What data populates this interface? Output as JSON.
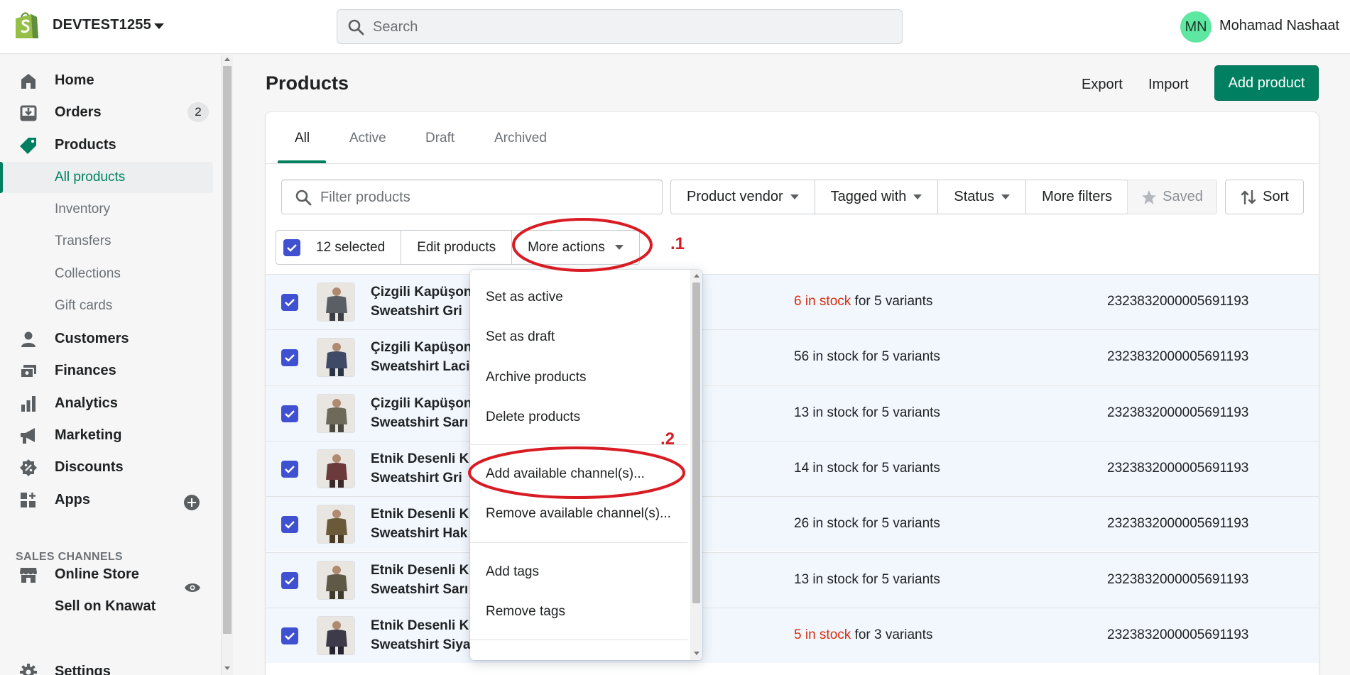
{
  "topbar": {
    "store_name": "DEVTEST1255",
    "search_placeholder": "Search",
    "avatar_initials": "MN",
    "user_name": "Mohamad Nashaat"
  },
  "sidebar": {
    "items": [
      {
        "label": "Home",
        "icon": "home-icon"
      },
      {
        "label": "Orders",
        "icon": "orders-icon",
        "badge": "2"
      },
      {
        "label": "Products",
        "icon": "tag-icon"
      },
      {
        "label": "All products"
      },
      {
        "label": "Inventory"
      },
      {
        "label": "Transfers"
      },
      {
        "label": "Collections"
      },
      {
        "label": "Gift cards"
      },
      {
        "label": "Customers",
        "icon": "person-icon"
      },
      {
        "label": "Finances",
        "icon": "finances-icon"
      },
      {
        "label": "Analytics",
        "icon": "bar-chart-icon"
      },
      {
        "label": "Marketing",
        "icon": "megaphone-icon"
      },
      {
        "label": "Discounts",
        "icon": "discount-icon"
      },
      {
        "label": "Apps",
        "icon": "apps-icon"
      }
    ],
    "sales_channels_title": "SALES CHANNELS",
    "channels": [
      {
        "label": "Online Store",
        "icon": "store-icon"
      },
      {
        "label": "Sell on Knawat"
      }
    ],
    "settings_label": "Settings"
  },
  "page": {
    "title": "Products",
    "export_label": "Export",
    "import_label": "Import",
    "add_label": "Add product"
  },
  "tabs": [
    "All",
    "Active",
    "Draft",
    "Archived"
  ],
  "filters": {
    "placeholder": "Filter products",
    "vendor": "Product vendor",
    "tagged": "Tagged with",
    "status": "Status",
    "more": "More filters",
    "saved": "Saved",
    "sort": "Sort"
  },
  "bulk": {
    "selected": "12 selected",
    "edit": "Edit products",
    "more_actions": "More actions"
  },
  "rows": [
    {
      "name1": "Çizgili Kapüşon",
      "name2": "Sweatshirt Gri",
      "stock": "6 in stock",
      "variants": " for 5 variants",
      "low": true,
      "vendor": "2323832000005691193"
    },
    {
      "name1": "Çizgili Kapüşon",
      "name2": "Sweatshirt Laci",
      "stock": "56 in stock",
      "variants": " for 5 variants",
      "low": false,
      "vendor": "2323832000005691193"
    },
    {
      "name1": "Çizgili Kapüşon",
      "name2": "Sweatshirt Sarı",
      "stock": "13 in stock",
      "variants": " for 5 variants",
      "low": false,
      "vendor": "2323832000005691193"
    },
    {
      "name1": "Etnik Desenli K",
      "name2": "Sweatshirt Gri",
      "stock": "14 in stock",
      "variants": " for 5 variants",
      "low": false,
      "vendor": "2323832000005691193"
    },
    {
      "name1": "Etnik Desenli K",
      "name2": "Sweatshirt Hak",
      "stock": "26 in stock",
      "variants": " for 5 variants",
      "low": false,
      "vendor": "2323832000005691193"
    },
    {
      "name1": "Etnik Desenli K",
      "name2": "Sweatshirt Sarı",
      "stock": "13 in stock",
      "variants": " for 5 variants",
      "low": false,
      "vendor": "2323832000005691193"
    },
    {
      "name1": "Etnik Desenli K",
      "name2": "Sweatshirt Siya",
      "stock": "5 in stock",
      "variants": " for 3 variants",
      "low": true,
      "vendor": "2323832000005691193"
    }
  ],
  "dropdown": {
    "items": [
      "Set as active",
      "Set as draft",
      "Archive products",
      "Delete products",
      "Add available channel(s)...",
      "Remove available channel(s)...",
      "Add tags",
      "Remove tags"
    ]
  },
  "annotations": {
    "mark1": ".1",
    "mark2": ".2",
    "color": "#d91c24"
  },
  "colors": {
    "brand": "#008060",
    "checkbox": "#3f51d1",
    "low_stock": "#d72c0d"
  }
}
